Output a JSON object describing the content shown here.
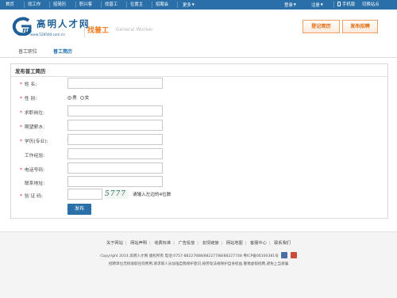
{
  "topnav": {
    "left_items": [
      "首页",
      "找工作",
      "招简历",
      "职兴客",
      "找普工",
      "位置主",
      "招聘会"
    ],
    "more": "更多",
    "login": "登录",
    "register": "注册",
    "mobile": "手机版",
    "switch_site": "切换站点"
  },
  "header": {
    "site_name": "高明人才网",
    "site_url": "www.528500.com.cn",
    "channel_cn": "找普工",
    "channel_en": "General Worker",
    "register_resume": "登记简历",
    "post_job": "发布招聘"
  },
  "tabs": [
    "普工职位",
    "普工简历"
  ],
  "form": {
    "title": "发布普工简历",
    "fields": [
      {
        "label": "姓  名:",
        "required": true
      },
      {
        "label": "性  别:",
        "required": true
      },
      {
        "label": "求职岗位:",
        "required": true
      },
      {
        "label": "期望薪水:",
        "required": true
      },
      {
        "label": "学历(专业):",
        "required": true
      },
      {
        "label": "工作经验:",
        "required": false
      },
      {
        "label": "电话号码:",
        "required": true
      },
      {
        "label": "联系地址:",
        "required": false
      },
      {
        "label": "验 证 码:",
        "required": true
      }
    ],
    "gender_male": "男",
    "gender_female": "女",
    "captcha_text": "5777",
    "captcha_hint": "请输入左边的4位数",
    "submit": "发布"
  },
  "footer": {
    "links": [
      "关于网站",
      "网站声明",
      "收费标准",
      "广告投放",
      "友情链接",
      "网站地图",
      "客服中心",
      "联系我们"
    ],
    "copyright": "Copyright 2014 高明人才网 版权所有 电话:0757-88227688/88227788/88227748 粤ICP备06100381号",
    "notice": "招聘单位无权收取任何费用,请求职人员加强自我保护意识,按劳动法规保护自身权益,警惕虚假招聘,避免上当受骗"
  },
  "colors": {
    "nav_bg": "#2a6fa8",
    "accent_orange": "#f07a1c",
    "brand_blue": "#1d5f96",
    "required_star": "#e0262c"
  }
}
